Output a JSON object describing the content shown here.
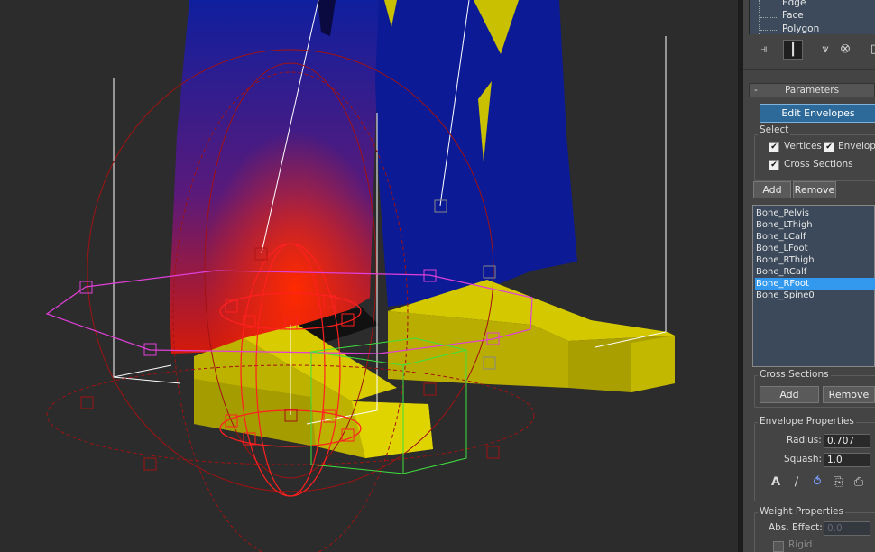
{
  "viewport": {
    "colors": {
      "background": "#2c2c2c",
      "leg_left": "#0f1f9e",
      "leg_right": "#0c1a95",
      "leg_highlight": "#d41a0a",
      "shoe_yellow": "#cfc400",
      "shoe_yellow_dark": "#8e8600",
      "envelope_red": "#b01414",
      "cross_section_magenta": "#e040d8",
      "bounding_green": "#44e044",
      "bone_white": "#ffffff"
    }
  },
  "panel": {
    "tree": {
      "items": [
        "Edge",
        "Face",
        "Polygon"
      ]
    },
    "toolbar": {
      "icons": [
        "pin-stack-icon",
        "modifier-active-icon",
        "show-end-result-icon",
        "make-unique-icon",
        "remove-modifier-icon"
      ]
    },
    "parameters": {
      "title": "Parameters",
      "collapse_symbol": "-",
      "edit_envelopes_label": "Edit Envelopes",
      "select_group_label": "Select",
      "vertices_label": "Vertices",
      "vertices_checked": true,
      "envelopes_label": "Envelop",
      "envelopes_checked": true,
      "cross_sections_label": "Cross Sections",
      "cross_sections_checked": true,
      "add_label": "Add",
      "remove_label": "Remove",
      "bones": [
        "Bone_Pelvis",
        "Bone_LThigh",
        "Bone_LCalf",
        "Bone_LFoot",
        "Bone_RThigh",
        "Bone_RCalf",
        "Bone_RFoot",
        "Bone_Spine0"
      ],
      "selected_bone": "Bone_RFoot",
      "cross_sections_group_label": "Cross Sections",
      "cs_add_label": "Add",
      "cs_remove_label": "Remove",
      "envelope_props_label": "Envelope Properties",
      "radius_label": "Radius:",
      "radius_value": "0.707",
      "squash_label": "Squash:",
      "squash_value": "1.0",
      "weight_props_label": "Weight Properties",
      "abs_effect_label": "Abs. Effect:",
      "abs_effect_value": "0.0",
      "rigid_label": "Rigid",
      "rigid_checked": false
    }
  }
}
